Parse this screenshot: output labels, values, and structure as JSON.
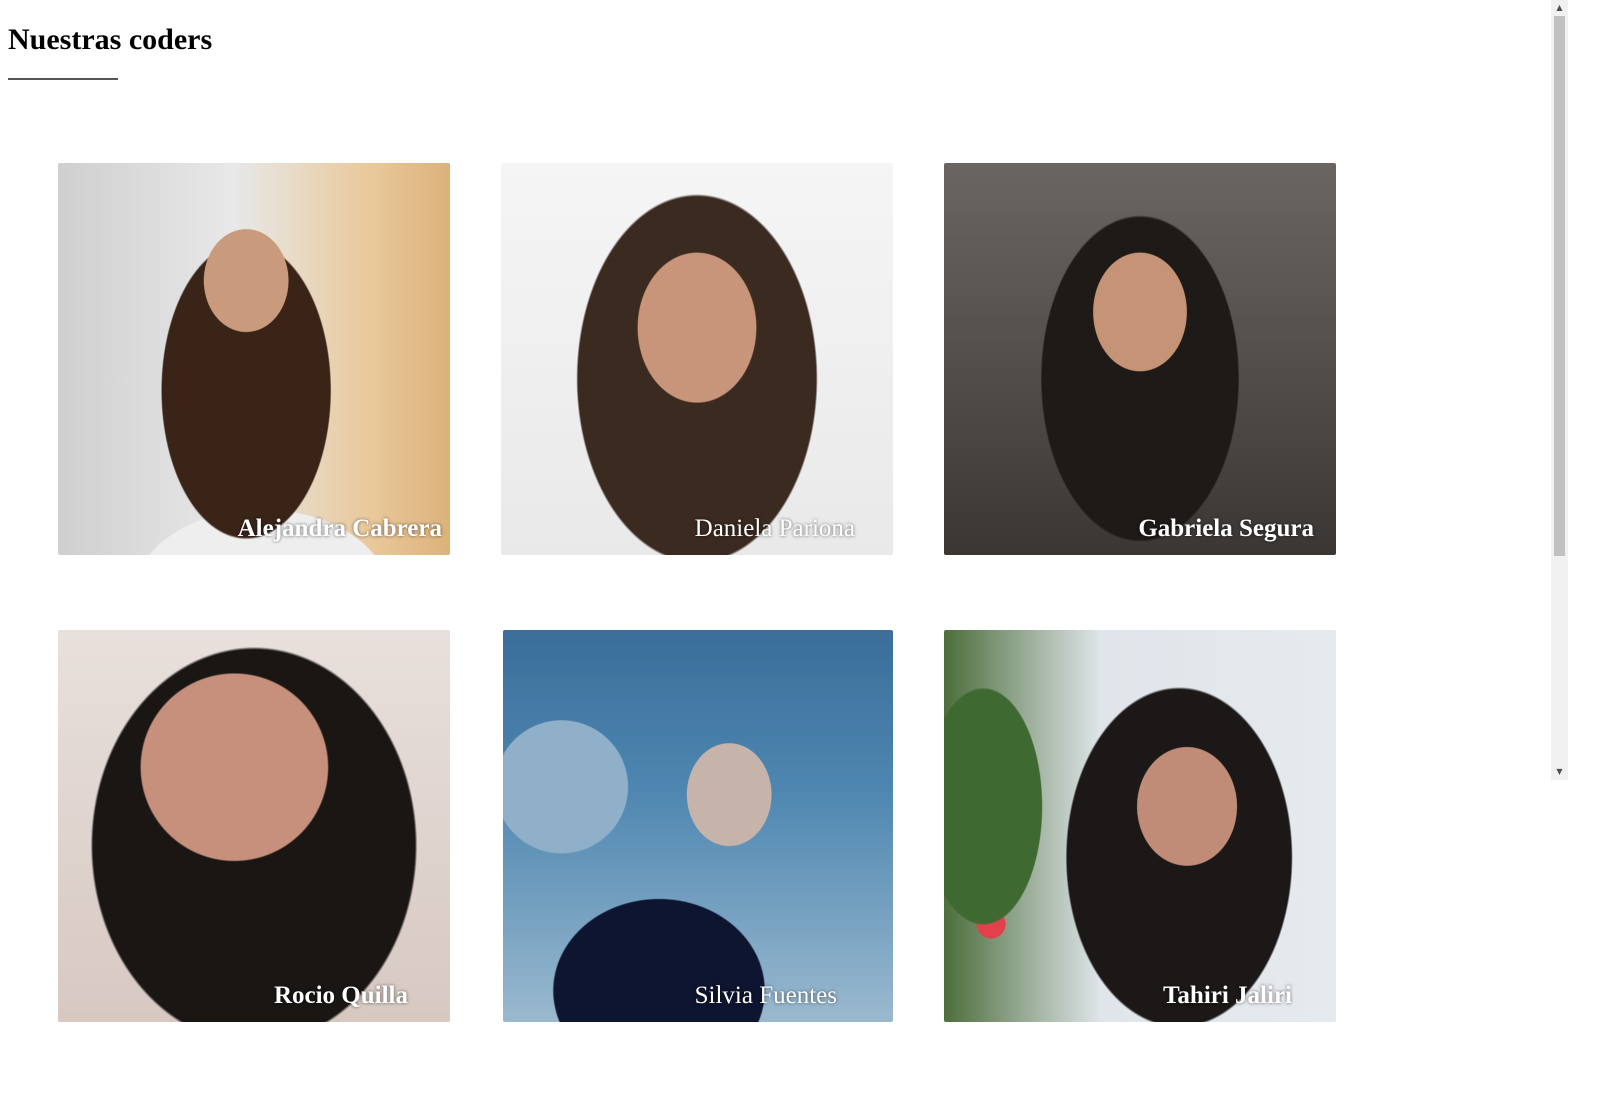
{
  "header": {
    "title": "Nuestras coders"
  },
  "coders": [
    {
      "name": "Alejandra Cabrera",
      "bold": true
    },
    {
      "name": "Daniela Pariona",
      "bold": false
    },
    {
      "name": "Gabriela Segura",
      "bold": true
    },
    {
      "name": "Rocio Quilla",
      "bold": true
    },
    {
      "name": "Silvia Fuentes",
      "bold": false
    },
    {
      "name": "Tahiri Jaliri",
      "bold": true
    }
  ],
  "scrollbar": {
    "up_icon": "chevron-up-icon",
    "down_icon": "chevron-down-icon"
  }
}
